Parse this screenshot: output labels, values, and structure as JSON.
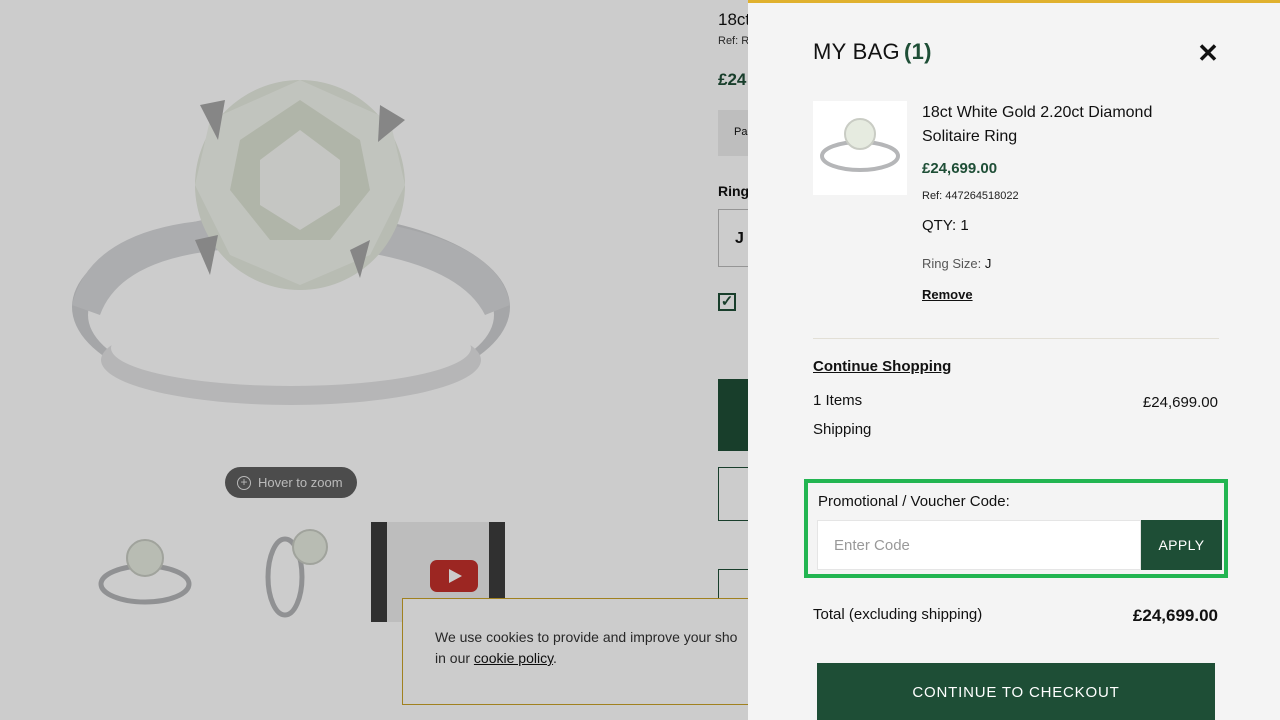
{
  "product_page": {
    "title": "18ct",
    "ref": "Ref: R",
    "price": "£24",
    "payment_snippet": "Pa",
    "ring_label": "Ring",
    "selected_size": "J",
    "zoom_hint": "Hover to zoom",
    "thumbnails": [
      "ring-front-thumbnail",
      "ring-side-thumbnail",
      "ring-video-thumbnail"
    ]
  },
  "cookie_banner": {
    "text_line1": "We use cookies to provide and improve your sho",
    "text_line2_prefix": "in our ",
    "link": "cookie policy",
    "text_line2_suffix": "."
  },
  "bag": {
    "title": "MY BAG",
    "count": "(1)",
    "close_icon": "close-icon",
    "item": {
      "name": "18ct White Gold 2.20ct Diamond Solitaire Ring",
      "price": "£24,699.00",
      "ref": "Ref: 447264518022",
      "qty": "QTY: 1",
      "ring_size_label": "Ring Size:",
      "ring_size_value": "J",
      "remove": "Remove"
    },
    "continue_shopping": "Continue Shopping",
    "summary": {
      "items_label": "1 Items",
      "items_value": "£24,699.00",
      "shipping_label": "Shipping"
    },
    "promo": {
      "label": "Promotional / Voucher Code:",
      "placeholder": "Enter Code",
      "apply": "APPLY"
    },
    "total_label": "Total (excluding shipping)",
    "total_value": "£24,699.00",
    "checkout": "CONTINUE TO CHECKOUT"
  },
  "colors": {
    "brand_green": "#1e4e36",
    "highlight_green": "#22b551",
    "top_accent": "#e0b12e",
    "drawer_bg": "#f4f4f4"
  }
}
